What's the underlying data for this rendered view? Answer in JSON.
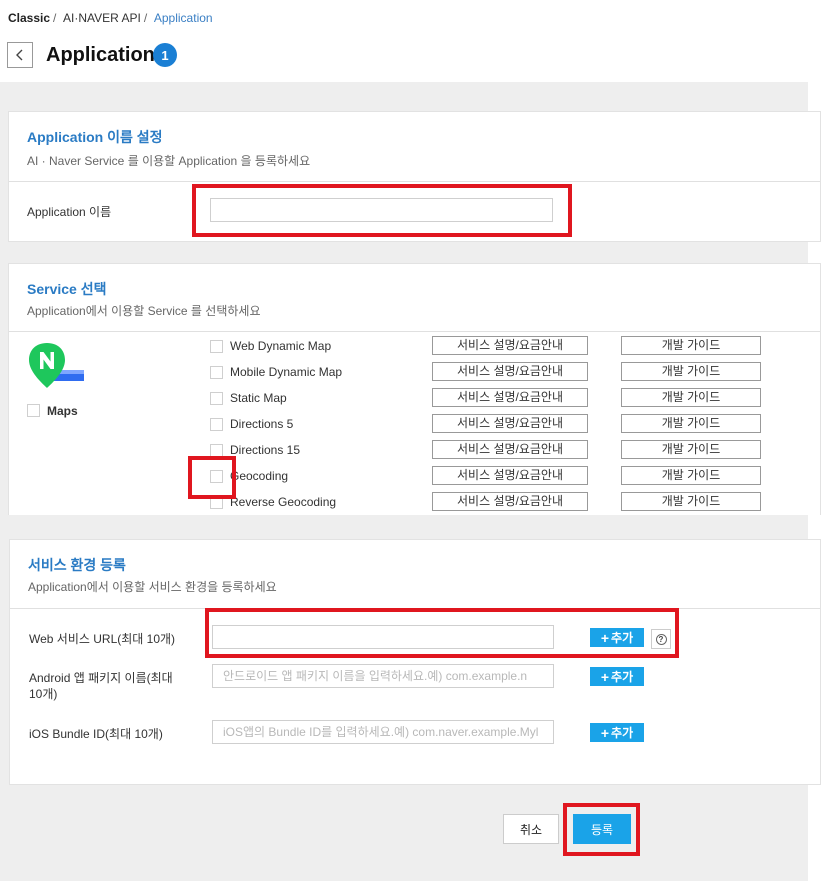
{
  "breadcrumb": {
    "items": [
      "Classic",
      "AI·NAVER API",
      "Application"
    ]
  },
  "header": {
    "title": "Application",
    "badge": "1"
  },
  "app_name_section": {
    "title": "Application 이름 설정",
    "subtitle": "AI · Naver Service 를 이용할 Application 을 등록하세요",
    "field_label": "Application 이름",
    "field_value": ""
  },
  "service_section": {
    "title": "Service 선택",
    "subtitle": "Application에서 이용할 Service 를 선택하세요",
    "group": {
      "label": "Maps",
      "checked": false,
      "logo_icon": "naver-maps-logo-icon"
    },
    "items": [
      {
        "label": "Web Dynamic Map",
        "checked": false
      },
      {
        "label": "Mobile Dynamic Map",
        "checked": false
      },
      {
        "label": "Static Map",
        "checked": false
      },
      {
        "label": "Directions 5",
        "checked": false
      },
      {
        "label": "Directions 15",
        "checked": false
      },
      {
        "label": "Geocoding",
        "checked": false
      },
      {
        "label": "Reverse Geocoding",
        "checked": false
      }
    ],
    "info_button_label": "서비스 설명/요금안내",
    "guide_button_label": "개발 가이드"
  },
  "env_section": {
    "title": "서비스 환경 등록",
    "subtitle": "Application에서 이용할 서비스 환경을 등록하세요",
    "web": {
      "label": "Web 서비스 URL(최대 10개)",
      "value": "",
      "placeholder": ""
    },
    "android": {
      "label_line1": "Android 앱 패키지 이름(최대",
      "label_line2": "10개)",
      "value": "",
      "placeholder": "안드로이드 앱 패키지 이름을 입력하세요.예) com.example.n"
    },
    "ios": {
      "label": "iOS Bundle ID(최대 10개)",
      "value": "",
      "placeholder": "iOS앱의 Bundle ID를 입력하세요.예) com.naver.example.Myl"
    },
    "add_button_label": "추가",
    "help_icon": "question-circle-icon"
  },
  "footer": {
    "cancel_label": "취소",
    "submit_label": "등록"
  },
  "colors": {
    "accent": "#1aa3e8",
    "title_blue": "#2a7bc4",
    "badge": "#1a7fd4",
    "highlight": "#e0161f"
  }
}
